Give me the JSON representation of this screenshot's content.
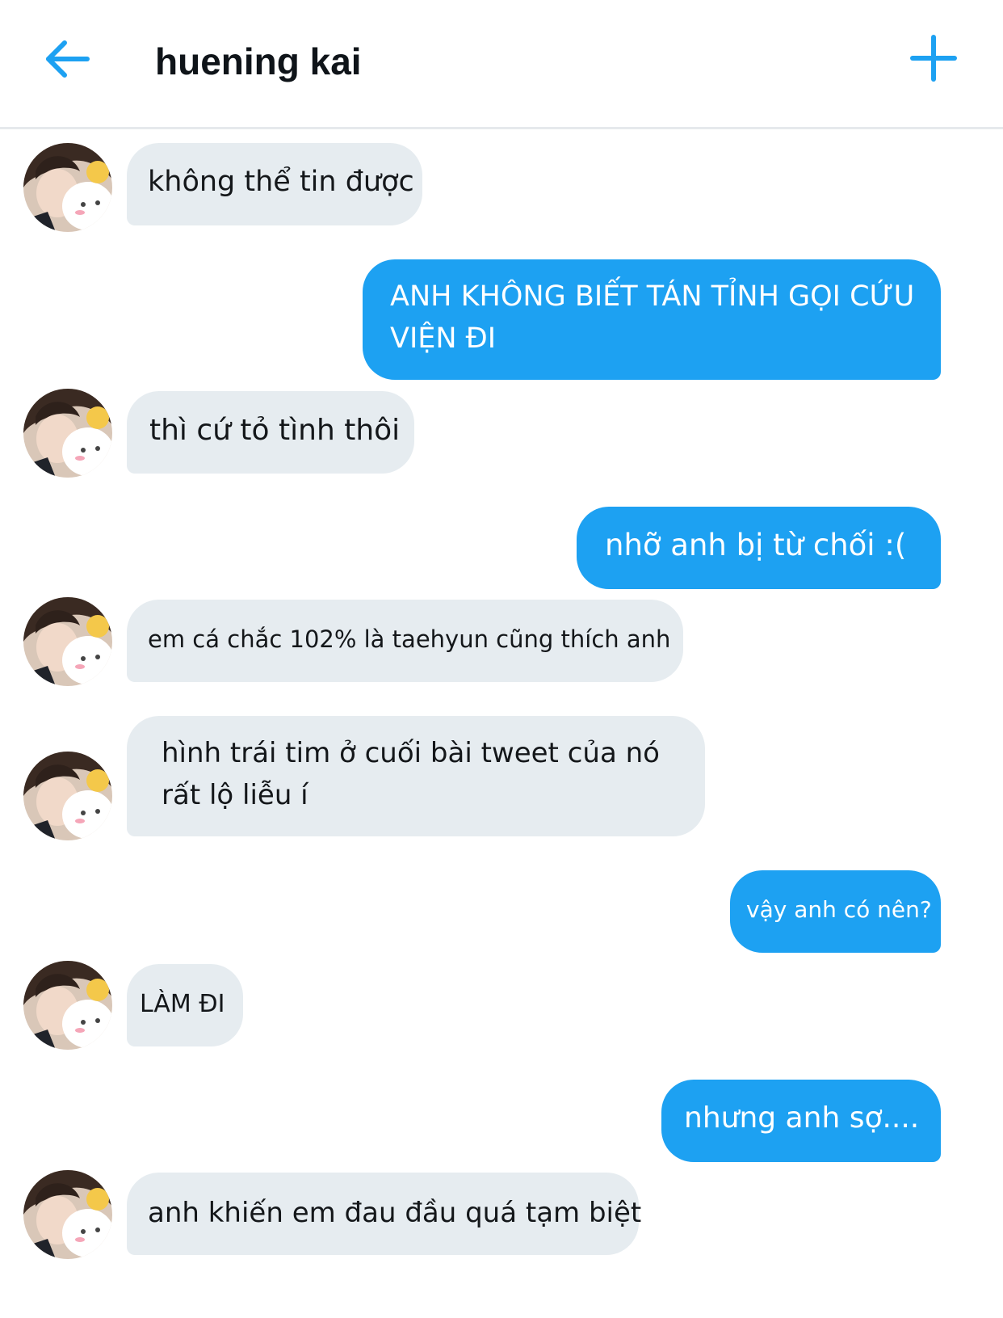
{
  "header": {
    "title": "huening kai",
    "back_icon": "arrow-left-icon",
    "add_icon": "plus-icon",
    "accent_color": "#1da1f2"
  },
  "conversation": {
    "messages": [
      {
        "from": "them",
        "text": "không thể tin được"
      },
      {
        "from": "me",
        "lines": [
          "ANH KHÔNG BIẾT TÁN TỈNH GỌI CỨU",
          "VIỆN ĐI"
        ]
      },
      {
        "from": "them",
        "text": "thì cứ tỏ tình thôi"
      },
      {
        "from": "me",
        "text": "nhỡ anh bị từ chối :("
      },
      {
        "from": "them",
        "text": "em cá chắc 102% là taehyun cũng thích anh"
      },
      {
        "from": "them",
        "lines": [
          "hình trái tim ở cuối bài tweet của nó",
          "rất lộ liễu í"
        ]
      },
      {
        "from": "me",
        "text": "vậy anh có nên?"
      },
      {
        "from": "them",
        "text": "LÀM ĐI"
      },
      {
        "from": "me",
        "text": "nhưng anh sợ...."
      },
      {
        "from": "them",
        "text": "anh khiến em đau đầu quá tạm biệt"
      }
    ]
  },
  "colors": {
    "sent_bubble": "#1da1f2",
    "received_bubble": "#e6ecf0"
  }
}
